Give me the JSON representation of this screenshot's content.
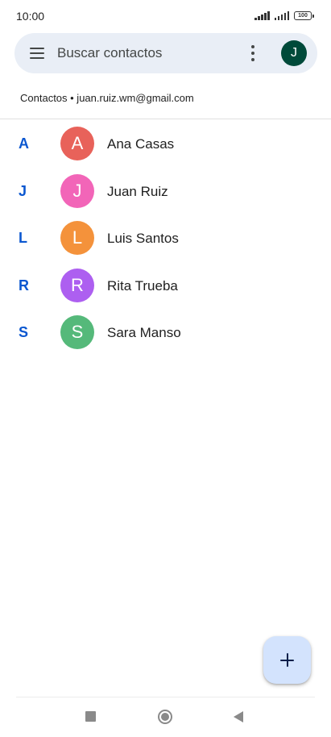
{
  "status_bar": {
    "time": "10:00",
    "battery": "100",
    "icons": [
      "signal-icon",
      "signal-icon",
      "battery-icon"
    ]
  },
  "search": {
    "placeholder": "Buscar contactos",
    "menu_icon": "menu-icon",
    "more_icon": "more-vert-icon",
    "account_initial": "J",
    "account_color": "#004a3a"
  },
  "account_label": "Contactos • juan.ruiz.wm@gmail.com",
  "contacts": [
    {
      "letter": "A",
      "initial": "A",
      "name": "Ana Casas",
      "color": "#e8625a"
    },
    {
      "letter": "J",
      "initial": "J",
      "name": "Juan Ruiz",
      "color": "#f265b8"
    },
    {
      "letter": "L",
      "initial": "L",
      "name": "Luis Santos",
      "color": "#f4923b"
    },
    {
      "letter": "R",
      "initial": "R",
      "name": "Rita Trueba",
      "color": "#ad5ff0"
    },
    {
      "letter": "S",
      "initial": "S",
      "name": "Sara Manso",
      "color": "#55b97a"
    }
  ],
  "fab": {
    "icon": "add-icon",
    "background": "#d3e3fd"
  },
  "navigation": {
    "icons": [
      "recents-icon",
      "home-icon",
      "back-icon"
    ]
  },
  "colors": {
    "section_letter": "#0b57d0",
    "search_background": "#e9eef6"
  }
}
